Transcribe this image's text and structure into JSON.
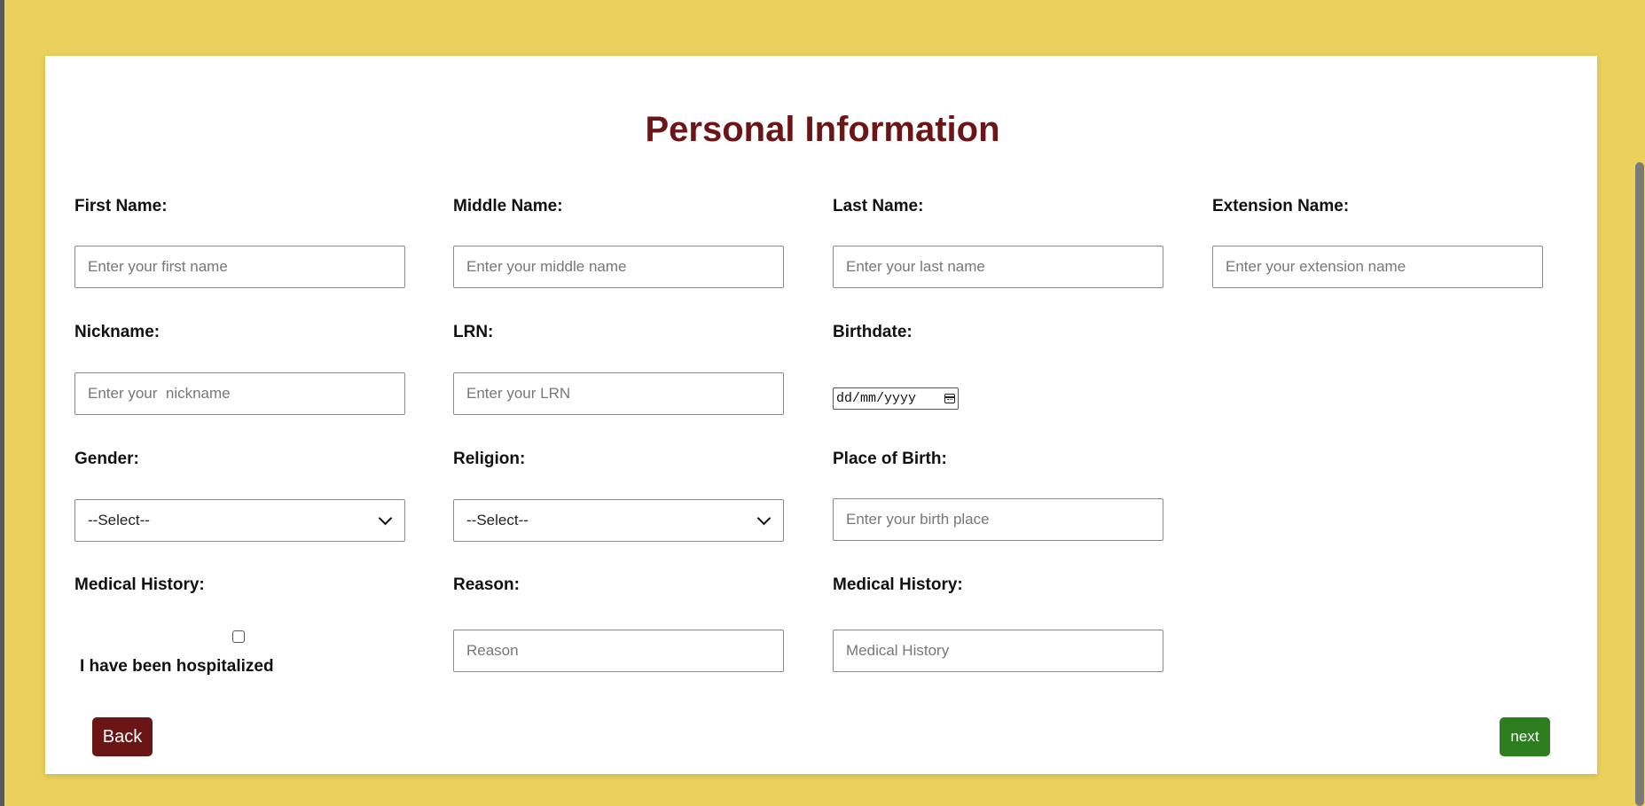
{
  "page": {
    "title": "Personal Information"
  },
  "colors": {
    "background": "#ebd15c",
    "title": "#6b1517",
    "back_button": "#6b1517",
    "next_button": "#2e7d1f"
  },
  "fields": {
    "first_name": {
      "label": "First Name:",
      "placeholder": "Enter your first name"
    },
    "middle_name": {
      "label": "Middle Name:",
      "placeholder": "Enter your middle name"
    },
    "last_name": {
      "label": "Last Name:",
      "placeholder": "Enter your last name"
    },
    "extension_name": {
      "label": "Extension Name:",
      "placeholder": "Enter your extension name"
    },
    "nickname": {
      "label": "Nickname:",
      "placeholder": "Enter your  nickname"
    },
    "lrn": {
      "label": "LRN:",
      "placeholder": "Enter your LRN"
    },
    "birthdate": {
      "label": "Birthdate:",
      "value": "dd/mm/yyyy"
    },
    "gender": {
      "label": "Gender:",
      "selected": "--Select--"
    },
    "religion": {
      "label": "Religion:",
      "selected": "--Select--"
    },
    "place_of_birth": {
      "label": "Place of Birth:",
      "placeholder": "Enter your birth place"
    },
    "medical_history_check": {
      "label": "Medical History:",
      "checkbox_label": "I have been hospitalized",
      "checked": false
    },
    "reason": {
      "label": "Reason:",
      "placeholder": "Reason"
    },
    "medical_history": {
      "label": "Medical History:",
      "placeholder": "Medical History"
    }
  },
  "buttons": {
    "back": "Back",
    "next": "next"
  }
}
